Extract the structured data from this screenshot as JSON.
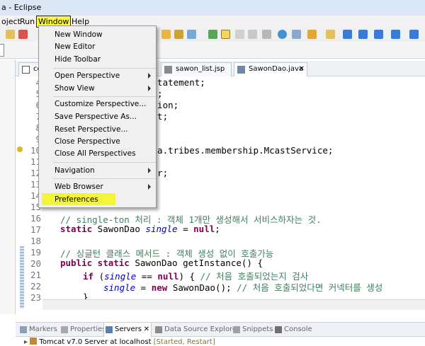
{
  "window": {
    "title": "a - Eclipse"
  },
  "menubar": {
    "items": [
      "oject",
      "Run",
      "Window",
      "Help"
    ]
  },
  "window_menu": {
    "group1": [
      "New Window",
      "New Editor",
      "Hide Toolbar"
    ],
    "group2": [
      "Open Perspective",
      "Show View"
    ],
    "group3": [
      "Customize Perspective...",
      "Save Perspective As...",
      "Reset Perspective...",
      "Close Perspective",
      "Close All Perspectives"
    ],
    "group4": [
      "Navigation"
    ],
    "group5": [
      "Web Browser",
      "Preferences"
    ]
  },
  "editor_tabs": [
    {
      "label": "co"
    },
    {
      "label": "sawon_list.jsp"
    },
    {
      "label": "SawonDao.java"
    }
  ],
  "gutter": [
    "4",
    "5",
    "6",
    "7",
    "8",
    "9",
    "10",
    "11",
    "12",
    "13",
    "14",
    "15",
    "16",
    "17",
    "18",
    "19",
    "20",
    "21",
    "22",
    "23"
  ],
  "code": {
    "l4": "dStatement;",
    "l5": "et;",
    "l6": "ption;",
    "l7": "ist;",
    "l10": "ina.tribes.membership.McastService;",
    "l12": "tor;",
    "l16": "// single-ton 처리 : 객체 1개만 생성해서 서비스하자는 것.",
    "l17_kw": "static",
    "l17_type": " SawonDao ",
    "l17_field": "single",
    "l17_rest": " = ",
    "l17_kw2": "null",
    "l17_end": ";",
    "l19": "// 싱글턴 클래스 메서드 : 객체 생성 없이 호출가능",
    "l20_kw": "public static",
    "l20_rest": " SawonDao getInstance() {",
    "l21_kw": "if",
    "l21_a": " (",
    "l21_field": "single",
    "l21_b": " == ",
    "l21_kw2": "null",
    "l21_c": ") { ",
    "l21_cm": "// 처음 호출되었는지 검사",
    "l22_field": "single",
    "l22_a": " = ",
    "l22_kw": "new",
    "l22_b": " SawonDao(); ",
    "l22_cm": "// 처음 호출되었다면 커넥터를 생성",
    "l23": "}"
  },
  "bottom_tabs": [
    "Markers",
    "Properties",
    "Servers",
    "Data Source Explorer",
    "Snippets",
    "Console"
  ],
  "servers": {
    "name": "Tomcat v7.0 Server at localhost",
    "status": "[Started, Restart]"
  },
  "colors": {
    "highlight": "#f4f43a",
    "keyword": "#7f0055",
    "comment": "#3f7f5f",
    "field": "#0000c0"
  }
}
